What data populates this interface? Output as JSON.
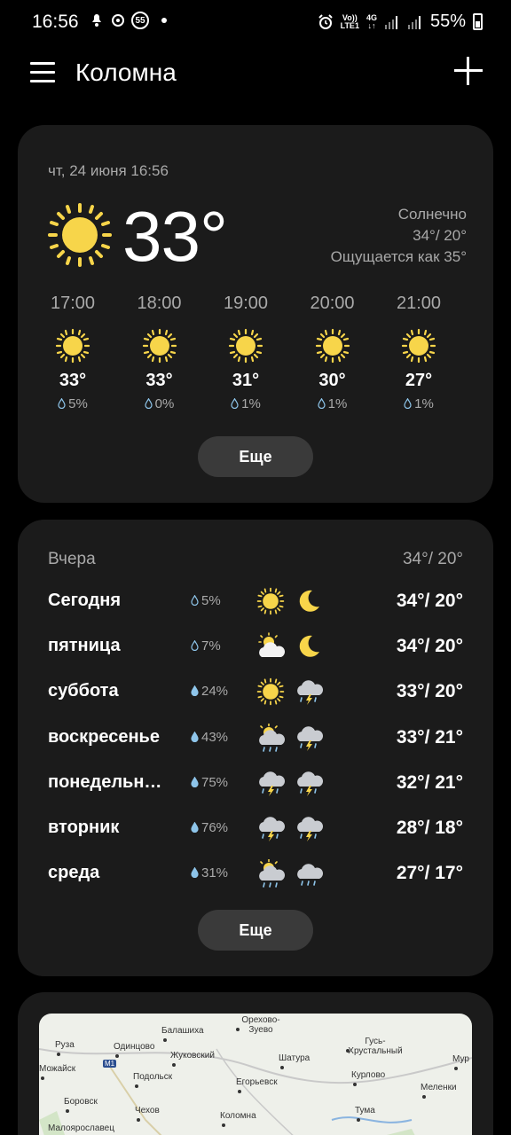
{
  "status_bar": {
    "time": "16:56",
    "badge": "55",
    "network_volte": "Vo))",
    "network_lte": "LTE1",
    "network_4g": "4G",
    "battery": "55%"
  },
  "header": {
    "city": "Коломна"
  },
  "current": {
    "date": "чт, 24 июня 16:56",
    "temperature": "33°",
    "condition": "Солнечно",
    "high_low": "34°/ 20°",
    "feels_like": "Ощущается как 35°",
    "icon": "sun-icon"
  },
  "hourly": [
    {
      "time": "17:00",
      "temp": "33°",
      "precip": "5%",
      "icon": "sun-icon"
    },
    {
      "time": "18:00",
      "temp": "33°",
      "precip": "0%",
      "icon": "sun-icon"
    },
    {
      "time": "19:00",
      "temp": "31°",
      "precip": "1%",
      "icon": "sun-icon"
    },
    {
      "time": "20:00",
      "temp": "30°",
      "precip": "1%",
      "icon": "sun-icon"
    },
    {
      "time": "21:00",
      "temp": "27°",
      "precip": "1%",
      "icon": "sun-icon"
    }
  ],
  "more_label": "Еще",
  "daily": {
    "yesterday_label": "Вчера",
    "yesterday_temp": "34°/ 20°",
    "days": [
      {
        "name": "Сегодня",
        "precip": "5%",
        "icon_day": "sun-icon",
        "icon_night": "moon-icon",
        "temp": "34°/ 20°"
      },
      {
        "name": "пятница",
        "precip": "7%",
        "icon_day": "partly-cloudy-icon",
        "icon_night": "moon-icon",
        "temp": "34°/ 20°"
      },
      {
        "name": "суббота",
        "precip": "24%",
        "icon_day": "sun-icon",
        "icon_night": "thunderstorm-icon",
        "temp": "33°/ 20°"
      },
      {
        "name": "воскресенье",
        "precip": "43%",
        "icon_day": "sun-rain-icon",
        "icon_night": "thunderstorm-icon",
        "temp": "33°/ 21°"
      },
      {
        "name": "понедельн…",
        "precip": "75%",
        "icon_day": "thunderstorm-icon",
        "icon_night": "thunderstorm-icon",
        "temp": "32°/ 21°"
      },
      {
        "name": "вторник",
        "precip": "76%",
        "icon_day": "thunderstorm-icon",
        "icon_night": "thunderstorm-icon",
        "temp": "28°/ 18°"
      },
      {
        "name": "среда",
        "precip": "31%",
        "icon_day": "sun-rain-icon",
        "icon_night": "rain-cloud-icon",
        "temp": "27°/ 17°"
      }
    ]
  },
  "map": {
    "labels": [
      "Балашиха",
      "Орехово-Зуево",
      "Руза",
      "Одинцово",
      "Жуковский",
      "Шатура",
      "Гусь-Хрустальный",
      "Мур",
      "Можайск",
      "Подольск",
      "Егорьевск",
      "Курлово",
      "Меленки",
      "Боровск",
      "Чехов",
      "Коломна",
      "Тума",
      "Малоярославец",
      "M1"
    ]
  },
  "colors": {
    "background": "#000000",
    "card": "#1b1b1b",
    "button": "#3a3a3a",
    "sun": "#f7d54a",
    "secondary_text": "#a9a9a9"
  }
}
